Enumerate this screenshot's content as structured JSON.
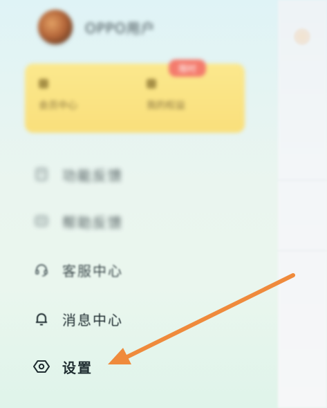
{
  "header": {
    "username": "OPPO用户",
    "avatar_icon": "avatar-photo"
  },
  "vip_card": {
    "badge": "限时",
    "items": [
      {
        "icon": "vip-icon",
        "label": "会员中心"
      },
      {
        "icon": "coin-icon",
        "label": "我的权益"
      }
    ],
    "background": "#fbe88d",
    "badge_color": "#f47b6d"
  },
  "menu": {
    "items": [
      {
        "icon": "file-icon",
        "label": "功能反馈"
      },
      {
        "icon": "chat-icon",
        "label": "帮助反馈"
      },
      {
        "icon": "headset-icon",
        "label": "客服中心"
      },
      {
        "icon": "bell-icon",
        "label": "消息中心"
      },
      {
        "icon": "settings-icon",
        "label": "设置"
      }
    ]
  },
  "annotation": {
    "color": "#ef8a3c",
    "target": "设置"
  }
}
